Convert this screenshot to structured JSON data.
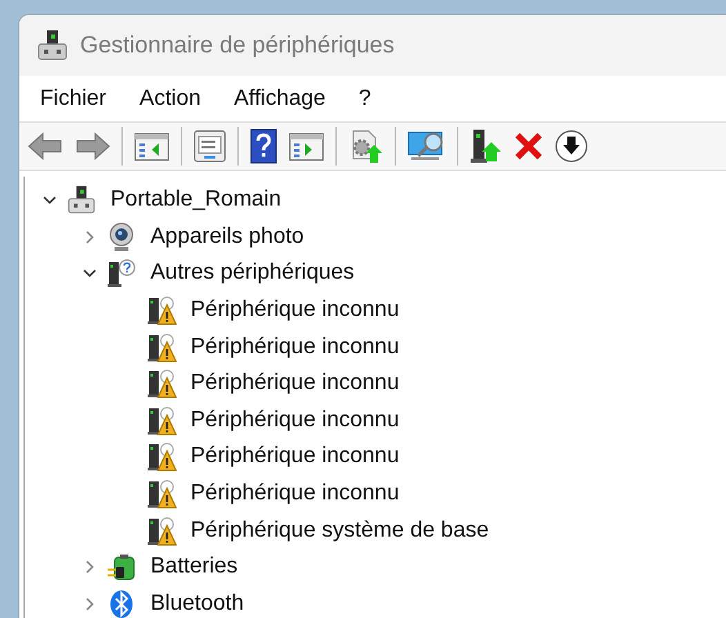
{
  "window": {
    "title": "Gestionnaire de périphériques"
  },
  "menu": [
    "Fichier",
    "Action",
    "Affichage",
    "?"
  ],
  "toolbar": [
    [
      {
        "kind": "back"
      },
      {
        "kind": "forward"
      }
    ],
    [
      {
        "kind": "panel-left"
      }
    ],
    [
      {
        "kind": "properties"
      }
    ],
    [
      {
        "kind": "help"
      },
      {
        "kind": "panel-right"
      }
    ],
    [
      {
        "kind": "update-driver"
      }
    ],
    [
      {
        "kind": "scan"
      }
    ],
    [
      {
        "kind": "enable"
      },
      {
        "kind": "remove"
      },
      {
        "kind": "download"
      }
    ]
  ],
  "tree": [
    {
      "label": "Portable_Romain",
      "kind": "computer",
      "expanded": true,
      "children": [
        {
          "label": "Appareils photo",
          "kind": "camera",
          "expanded": false
        },
        {
          "label": "Autres périphériques",
          "kind": "other",
          "expanded": true,
          "children": [
            {
              "label": "Périphérique inconnu",
              "kind": "warning"
            },
            {
              "label": "Périphérique inconnu",
              "kind": "warning"
            },
            {
              "label": "Périphérique inconnu",
              "kind": "warning"
            },
            {
              "label": "Périphérique inconnu",
              "kind": "warning"
            },
            {
              "label": "Périphérique inconnu",
              "kind": "warning"
            },
            {
              "label": "Périphérique inconnu",
              "kind": "warning"
            },
            {
              "label": "Périphérique système de base",
              "kind": "warning"
            }
          ]
        },
        {
          "label": "Batteries",
          "kind": "battery",
          "expanded": false
        },
        {
          "label": "Bluetooth",
          "kind": "bluetooth",
          "expanded": false
        }
      ]
    }
  ]
}
